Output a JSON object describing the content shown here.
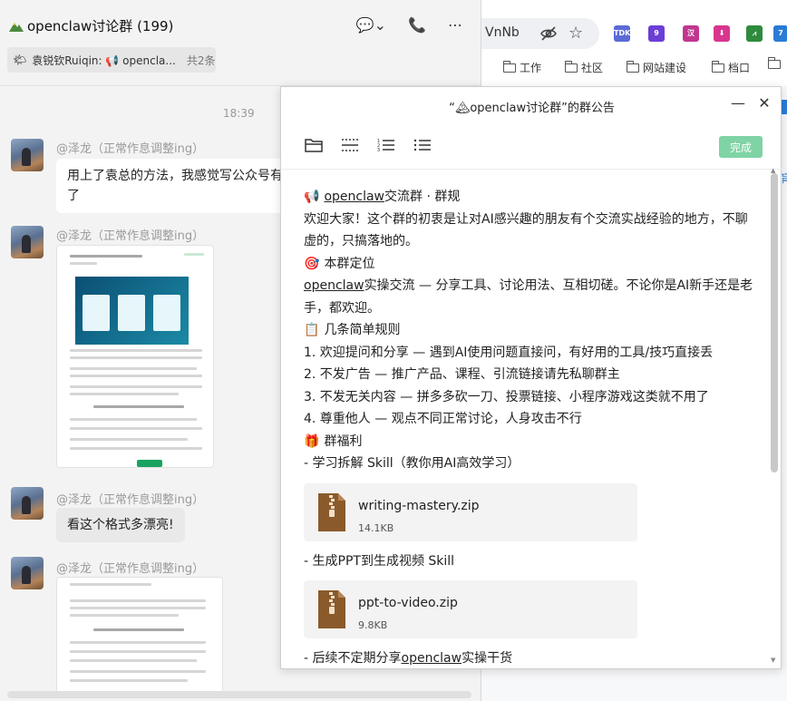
{
  "browser": {
    "address_text": "VnNb",
    "extensions": [
      {
        "name": "TDK",
        "color": "#5b6bd6"
      },
      {
        "name": "9",
        "color": "#6b3fd6"
      },
      {
        "name": "汉",
        "color": "#c2368f"
      },
      {
        "name": "",
        "color": "#d9368f"
      },
      {
        "name": "",
        "color": "#2e8b3d"
      },
      {
        "name": "7",
        "color": "#2a7bd6"
      }
    ],
    "bookmarks": [
      "工作",
      "社区",
      "网站建设",
      "档口",
      ""
    ],
    "right_edge_text": "肓"
  },
  "chat": {
    "title": "openclaw讨论群 (199)",
    "pinned": {
      "text": "袁锐钦Ruiqin: 📢 opencla...",
      "count": "共2条"
    },
    "timestamp": "18:39",
    "messages": [
      {
        "sender": "@泽龙（正常作息调整ing）",
        "text_line1": "用上了袁总的方法，我感觉写公众号有",
        "text_line2": "了"
      },
      {
        "sender": "@泽龙（正常作息调整ing）"
      },
      {
        "sender": "@泽龙（正常作息调整ing）",
        "text_line1": "看这个格式多漂亮!"
      },
      {
        "sender": "@泽龙（正常作息调整ing）"
      }
    ],
    "thumb1_heading": "一、核心目标：新型能源系\"组合建设\""
  },
  "modal": {
    "title": "“🏔openclaw讨论群”的群公告",
    "done_label": "完成",
    "heading": {
      "emoji": "📢",
      "link": "openclaw",
      "rest": "交流群 · 群规"
    },
    "intro": "欢迎大家！这个群的初衷是让对AI感兴趣的朋友有个交流实战经验的地方，不聊虚的，只搞落地的。",
    "section1": {
      "emoji": "🎯",
      "title": "本群定位"
    },
    "positioning": {
      "link": "openclaw",
      "rest": "实操交流 — 分享工具、讨论用法、互相切磋。不论你是AI新手还是老手，都欢迎。"
    },
    "section2": {
      "emoji": "📋",
      "title": "几条简单规则"
    },
    "rules": [
      "1. 欢迎提问和分享 — 遇到AI使用问题直接问，有好用的工具/技巧直接丢",
      "2. 不发广告 — 推广产品、课程、引流链接请先私聊群主",
      "3. 不发无关内容 — 拼多多砍一刀、投票链接、小程序游戏这类就不用了",
      "4. 尊重他人 — 观点不同正常讨论，人身攻击不行"
    ],
    "section3": {
      "emoji": "🎁",
      "title": "群福利"
    },
    "benefit1": "- 学习拆解 Skill（教你用AI高效学习）",
    "file1": {
      "name": "writing-mastery.zip",
      "size": "14.1KB"
    },
    "benefit2": "- 生成PPT到生成视频 Skill",
    "file2": {
      "name": "ppt-to-video.zip",
      "size": "9.8KB"
    },
    "benefit3": {
      "prefix": "- 后续不定期分享",
      "link": "openclaw",
      "suffix": "实操干货"
    }
  }
}
